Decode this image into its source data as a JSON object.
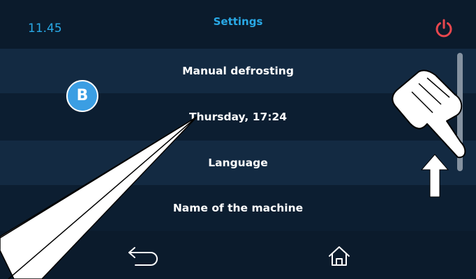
{
  "header": {
    "time": "11.45",
    "title": "Settings",
    "power_icon": "power-icon"
  },
  "colors": {
    "background": "#0b1b2c",
    "row_light": "#132a42",
    "row_dark": "#0c1e31",
    "accent_blue": "#29a9e6",
    "power_red": "#e8474e",
    "badge_blue": "#3b9ee3"
  },
  "menu": {
    "items": [
      {
        "label": "Manual defrosting"
      },
      {
        "label": "Thursday, 17:24"
      },
      {
        "label": "Language"
      },
      {
        "label": "Name of the machine"
      }
    ]
  },
  "callout": {
    "badge_letter": "B"
  },
  "footer": {
    "back_icon": "back-arrow-icon",
    "home_icon": "home-icon"
  }
}
